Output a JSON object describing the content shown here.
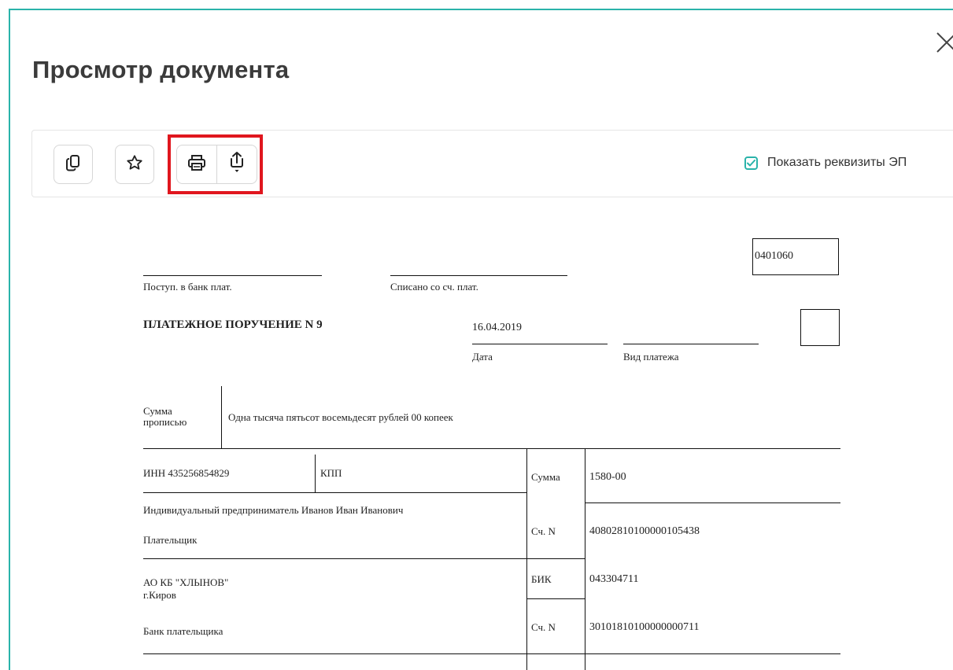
{
  "dialog": {
    "title": "Просмотр документа"
  },
  "toolbar": {
    "buttons": [
      {
        "icon": "copy-icon"
      },
      {
        "icon": "star-icon"
      },
      {
        "icon": "print-icon"
      },
      {
        "icon": "export-icon"
      }
    ],
    "show_ep_label": "Показать реквизиты ЭП",
    "show_ep_checked": true
  },
  "colors": {
    "accent": "#2ab3aa",
    "highlight": "#e0161e"
  },
  "document": {
    "form_code": "0401060",
    "received_label": "Поступ. в банк плат.",
    "debited_label": "Списано со сч. плат.",
    "title": "ПЛАТЕЖНОЕ ПОРУЧЕНИЕ N 9",
    "date": "16.04.2019",
    "date_label": "Дата",
    "payment_type_label": "Вид платежа",
    "amount_words_label": "Сумма прописью",
    "amount_words": "Одна тысяча пятьсот восемьдесят рублей 00 копеек",
    "inn_label": "ИНН 435256854829",
    "kpp_label": "КПП",
    "sum_label": "Сумма",
    "sum": "1580-00",
    "payer_name": "Индивидуальный предприниматель Иванов Иван Иванович",
    "payer_label": "Плательщик",
    "account_label": "Сч. N",
    "payer_account": "40802810100000105438",
    "bank_name": "АО КБ \"ХЛЫНОВ\"",
    "bank_city": "г.Киров",
    "bank_label": "Банк плательщика",
    "bik_label": "БИК",
    "bik": "043304711",
    "corr_account_label": "Сч. N",
    "corr_account": "30101810100000000711"
  }
}
